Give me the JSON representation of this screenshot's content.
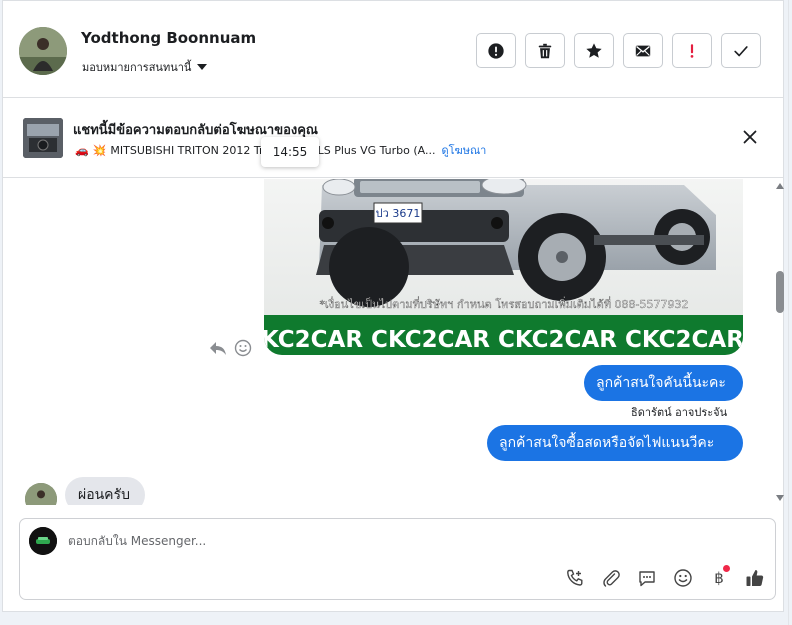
{
  "header": {
    "user_name": "Yodthong Boonnuam",
    "assign_label": "มอบหมายการสนทนานี้",
    "actions": [
      {
        "name": "mark-spam-button",
        "icon": "alert-circle-icon"
      },
      {
        "name": "delete-button",
        "icon": "trash-icon"
      },
      {
        "name": "star-button",
        "icon": "star-icon"
      },
      {
        "name": "mark-unread-button",
        "icon": "envelope-icon"
      },
      {
        "name": "follow-up-button",
        "icon": "exclamation-icon"
      },
      {
        "name": "mark-done-button",
        "icon": "check-icon"
      }
    ]
  },
  "ad": {
    "title": "แชทนี้มีข้อความตอบกลับต่อโฆษณาของคุณ",
    "subtitle": "MITSUBISHI TRITON 2012 Triton 2.5 GLS Plus VG Turbo (A...",
    "link": "ดูโฆษณา",
    "tooltip_time": "14:55"
  },
  "chat": {
    "image_plate": "ปว 3671",
    "image_caption": "*เงื่อนไขเป็นไปตามที่บริษัทฯ กำหนด โทรสอบถามเพิ่มเติมได้ที่ 088-5577932",
    "image_banner": "CKC2CAR CKC2CAR CKC2CAR CKC2CAR",
    "messages_out": [
      {
        "text": "ลูกค้าสนใจคันนี้นะคะ"
      },
      {
        "text": "ลูกค้าสนใจซื้อสดหรือจัดไฟแนนวีคะ"
      }
    ],
    "sender": "ธิดารัตน์ อาจประจัน",
    "messages_in": [
      {
        "text": "ผ่อนครับ"
      }
    ]
  },
  "composer": {
    "placeholder": "ตอบกลับใน Messenger..."
  },
  "colors": {
    "accent": "#1b74e4",
    "incoming_bubble": "#e4e6eb",
    "alert_red": "#e41e3f"
  }
}
